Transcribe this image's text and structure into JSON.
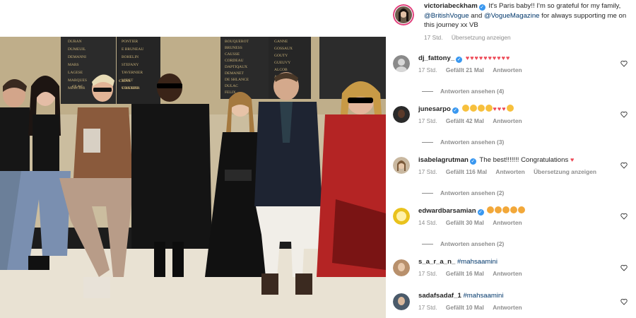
{
  "post": {
    "username": "victoriabeckham",
    "verified_symbol": "✓",
    "caption_intro": "It's Paris baby!! I'm so grateful for my family, ",
    "mention_1": "@BritishVogue",
    "caption_and": " and ",
    "mention_2": "@VogueMagazine",
    "caption_outro": " for always supporting me on this journey xx VB",
    "time": "17 Std.",
    "translate_label": "Übersetzung anzeigen"
  },
  "photo": {
    "plaque_left": [
      "DURAN",
      "DUMEUIL",
      "DEMANNI",
      "MARS",
      "LAGESE",
      "MARQUES",
      "MERCIER"
    ],
    "plaque_mid": [
      "PONTIER",
      "E BRUNEAU",
      "BOHELIN",
      "STEFANY",
      "TAVERNIER",
      "VIDET",
      "VILLAIN"
    ],
    "plaque_right": [
      "BOUQUEROT",
      "BRUNESS",
      "CAUSSE",
      "CORDEAU",
      "DAPTIQAUX",
      "DEMANET",
      "DE SHLANCE",
      "DULAC",
      "FELIX"
    ],
    "plaque_right2": [
      "GANNE",
      "GOSSAUX",
      "GOUTY",
      "GUEUVY",
      "ALCOB",
      "ARTIN"
    ],
    "sign_left": "CLAC",
    "sign_mid": "CIENS",
    "sign_mid2": "CONTIER"
  },
  "comments": [
    {
      "username": "dj_fattony_",
      "verified": true,
      "text": "",
      "hearts": "♥♥♥♥♥♥♥♥♥♥",
      "time": "17 Std.",
      "likes": "Gefällt 21 Mal",
      "reply": "Antworten",
      "translate": "",
      "view_replies": "Antworten ansehen (4)"
    },
    {
      "username": "junesarpo",
      "verified": true,
      "text": "",
      "hearts": "♥♥♥",
      "time": "17 Std.",
      "likes": "Gefällt 42 Mal",
      "reply": "Antworten",
      "translate": "",
      "view_replies": "Antworten ansehen (3)"
    },
    {
      "username": "isabelagrutman",
      "verified": true,
      "text": "The best!!!!!!! Congratulations ",
      "hearts": "♥",
      "time": "17 Std.",
      "likes": "Gefällt 116 Mal",
      "reply": "Antworten",
      "translate": "Übersetzung anzeigen",
      "view_replies": "Antworten ansehen (2)"
    },
    {
      "username": "edwardbarsamian",
      "verified": true,
      "text": "",
      "hearts": "",
      "time": "14 Std.",
      "likes": "Gefällt 30 Mal",
      "reply": "Antworten",
      "translate": "",
      "view_replies": "Antworten ansehen (2)"
    },
    {
      "username": "s_a_r_a_n_",
      "verified": false,
      "text": "#mahsaamini",
      "hearts": "",
      "time": "17 Std.",
      "likes": "Gefällt 16 Mal",
      "reply": "Antworten",
      "translate": "",
      "view_replies": ""
    },
    {
      "username": "sadafsadaf_1",
      "verified": false,
      "text": "#mahsaamini",
      "hearts": "",
      "time": "17 Std.",
      "likes": "Gefällt 10 Mal",
      "reply": "Antworten",
      "translate": "",
      "view_replies": ""
    }
  ],
  "colors": {
    "verified": "#3897f0",
    "heart": "#ed4956",
    "mention": "#00376b",
    "meta": "#8e8e8e"
  }
}
